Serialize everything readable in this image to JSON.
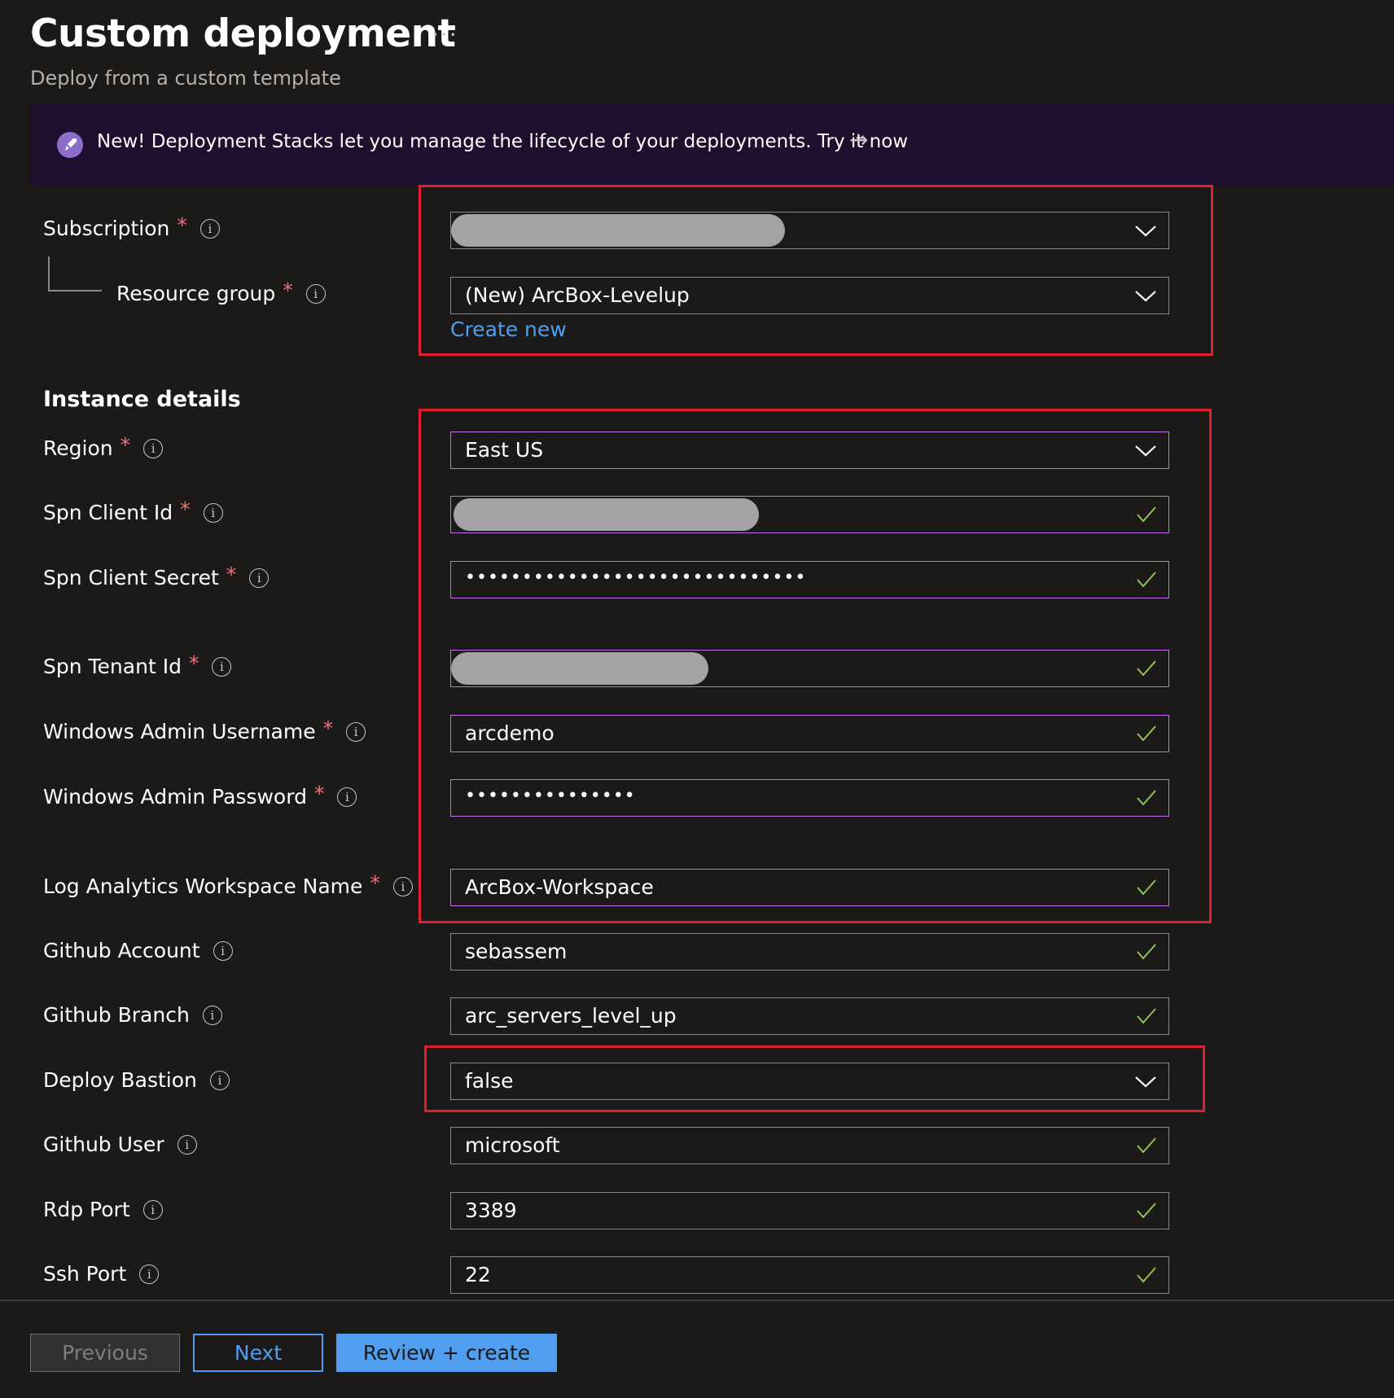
{
  "header": {
    "title": "Custom deployment",
    "more_label": "···",
    "subtitle": "Deploy from a custom template"
  },
  "banner": {
    "text": "New! Deployment Stacks let you manage the lifecycle of your deployments. Try it now",
    "arrow": "→",
    "icon": "rocket-icon"
  },
  "project": {
    "subscription_label": "Subscription",
    "resource_group_label": "Resource group",
    "resource_group_value": "(New) ArcBox-Levelup",
    "create_new_link": "Create new"
  },
  "instance": {
    "heading": "Instance details",
    "region_label": "Region",
    "region_value": "East US",
    "spn_client_id_label": "Spn Client Id",
    "spn_client_secret_label": "Spn Client Secret",
    "spn_client_secret_value": "••••••••••••••••••••••••••••••",
    "spn_tenant_id_label": "Spn Tenant Id",
    "windows_admin_username_label": "Windows Admin Username",
    "windows_admin_username_value": "arcdemo",
    "windows_admin_password_label": "Windows Admin Password",
    "windows_admin_password_value": "•••••••••••••••",
    "log_analytics_label": "Log Analytics Workspace Name",
    "log_analytics_value": "ArcBox-Workspace",
    "github_account_label": "Github Account",
    "github_account_value": "sebassem",
    "github_branch_label": "Github Branch",
    "github_branch_value": "arc_servers_level_up",
    "deploy_bastion_label": "Deploy Bastion",
    "deploy_bastion_value": "false",
    "github_user_label": "Github User",
    "github_user_value": "microsoft",
    "rdp_port_label": "Rdp Port",
    "rdp_port_value": "3389",
    "ssh_port_label": "Ssh Port",
    "ssh_port_value": "22"
  },
  "common": {
    "required_marker": "*",
    "info_glyph": "i"
  },
  "footer": {
    "previous_label": "Previous",
    "next_label": "Next",
    "review_label": "Review + create"
  },
  "colors": {
    "background": "#1b1a19",
    "banner_bg": "#1f0f2e",
    "accent_blue": "#4f9ef0",
    "focus_purple": "#c471ed",
    "highlight_red": "#e0202e",
    "valid_green": "#92c353",
    "required_red": "#f1707b"
  }
}
